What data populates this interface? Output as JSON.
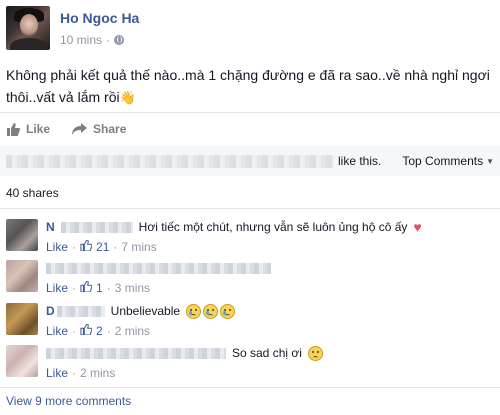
{
  "post": {
    "author": "Ho Ngoc Ha",
    "time": "10 mins",
    "time_separator": "·",
    "privacy_icon": "globe-icon",
    "text": "Không phải kết quả thế nào..mà 1 chặng đường e đã ra sao..về nhà nghỉ ngơi thôi..vất vả lắm rồi",
    "text_trailing_icon": "wave-icon"
  },
  "actions": {
    "like_label": "Like",
    "share_label": "Share"
  },
  "summary": {
    "like_suffix": "like this.",
    "sort_label": "Top Comments",
    "shares": "40 shares"
  },
  "comments": [
    {
      "name": "N",
      "text": "Hơi tiếc một chút, nhưng vẫn sẽ luôn ủng hộ cô ấy",
      "trailing_icon": "heart-icon",
      "like_label": "Like",
      "dot": "·",
      "like_count": "21",
      "time": "7 mins"
    },
    {
      "name": "",
      "text": "",
      "like_label": "Like",
      "dot": "·",
      "like_count": "1",
      "time": "3 mins"
    },
    {
      "name": "D",
      "text": "Unbelievable",
      "trailing_icon": "crying-emoji-icon",
      "like_label": "Like",
      "dot": "·",
      "like_count": "2",
      "time": "2 mins"
    },
    {
      "name": "",
      "text": "So sad chị ơi",
      "trailing_icon": "sad-emoji-icon",
      "like_label": "Like",
      "dot": "·",
      "time": "2 mins"
    }
  ],
  "view_more": "View 9 more comments",
  "colors": {
    "link_blue": "#3b5998",
    "meta_gray": "#9197a3",
    "summary_bg": "#f6f7f9"
  }
}
